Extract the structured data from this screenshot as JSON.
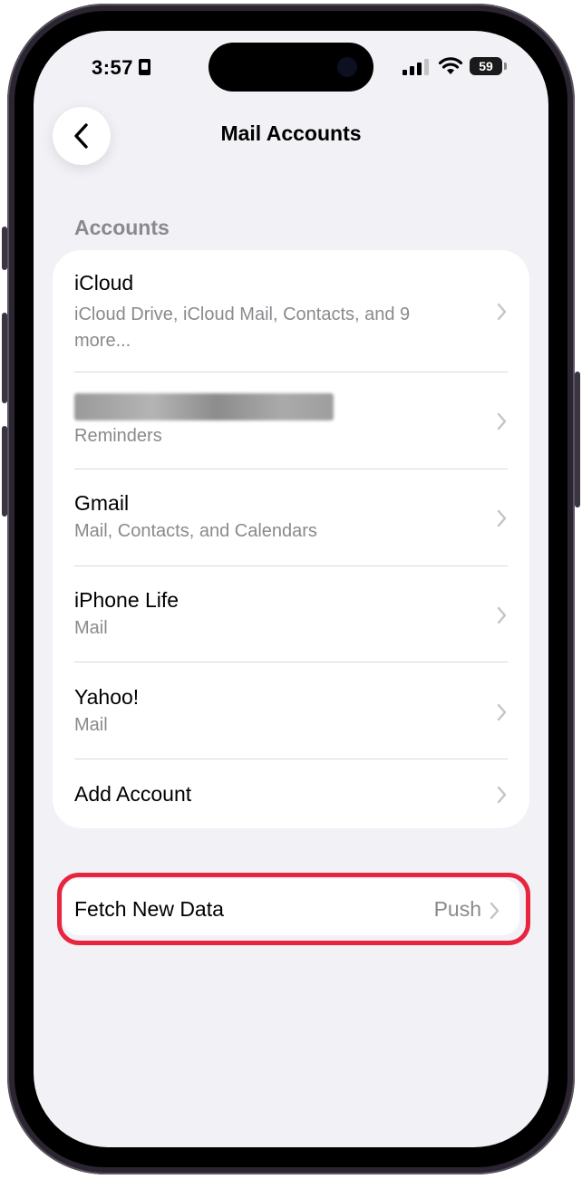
{
  "status_bar": {
    "time": "3:57",
    "battery": "59"
  },
  "nav": {
    "title": "Mail Accounts"
  },
  "accounts_section": {
    "header": "Accounts",
    "items": [
      {
        "title": "iCloud",
        "subtitle": "iCloud Drive, iCloud Mail, Contacts, and 9 more..."
      },
      {
        "title": "",
        "subtitle": "Reminders"
      },
      {
        "title": "Gmail",
        "subtitle": "Mail, Contacts, and Calendars"
      },
      {
        "title": "iPhone Life",
        "subtitle": "Mail"
      },
      {
        "title": "Yahoo!",
        "subtitle": "Mail"
      }
    ],
    "add_account": "Add Account"
  },
  "fetch": {
    "title": "Fetch New Data",
    "value": "Push",
    "highlight_color": "#e8253f"
  }
}
